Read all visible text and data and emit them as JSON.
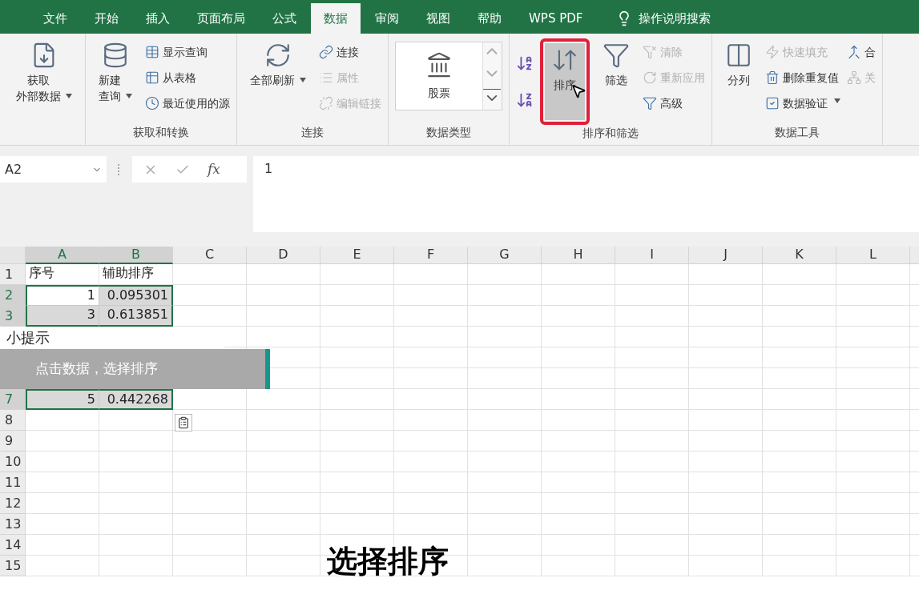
{
  "tabs": [
    {
      "label": "文件",
      "selected": false
    },
    {
      "label": "开始",
      "selected": false
    },
    {
      "label": "插入",
      "selected": false
    },
    {
      "label": "页面布局",
      "selected": false
    },
    {
      "label": "公式",
      "selected": false
    },
    {
      "label": "数据",
      "selected": true
    },
    {
      "label": "审阅",
      "selected": false
    },
    {
      "label": "视图",
      "selected": false
    },
    {
      "label": "帮助",
      "selected": false
    },
    {
      "label": "WPS PDF",
      "selected": false
    }
  ],
  "tell_me": {
    "label": "操作说明搜索"
  },
  "ribbon": {
    "groups": [
      {
        "columns": [
          {
            "kind": "large",
            "lines": [
              "获取",
              "外部数据"
            ],
            "caret": true,
            "selected": false,
            "highlighted": false
          }
        ]
      },
      {
        "label": "获取和转换",
        "columns": [
          {
            "kind": "large",
            "lines": [
              "新建",
              "查询"
            ],
            "caret": true,
            "selected": false,
            "highlighted": false
          },
          {
            "kind": "stack",
            "items": [
              {
                "label": "显示查询",
                "disabled": false
              },
              {
                "label": "从表格",
                "disabled": false
              },
              {
                "label": "最近使用的源",
                "disabled": false
              }
            ]
          }
        ]
      },
      {
        "label": "连接",
        "columns": [
          {
            "kind": "large",
            "lines": [
              "全部刷新"
            ],
            "caret": true,
            "selected": false,
            "highlighted": false
          },
          {
            "kind": "stack",
            "items": [
              {
                "label": "连接",
                "disabled": false
              },
              {
                "label": "属性",
                "disabled": true
              },
              {
                "label": "编辑链接",
                "disabled": true
              }
            ]
          }
        ]
      },
      {
        "label": "数据类型",
        "columns": [
          {
            "kind": "gallery",
            "label": "股票"
          }
        ]
      },
      {
        "label": "排序和筛选",
        "columns": [
          {
            "kind": "sort_buttons"
          },
          {
            "kind": "large",
            "lines": [
              "排序"
            ],
            "caret": false,
            "selected": true,
            "highlighted": true
          },
          {
            "kind": "large",
            "lines": [
              "筛选"
            ],
            "caret": false,
            "selected": false,
            "highlighted": false
          },
          {
            "kind": "stack",
            "items": [
              {
                "label": "清除",
                "disabled": true
              },
              {
                "label": "重新应用",
                "disabled": true
              },
              {
                "label": "高级",
                "disabled": false
              }
            ]
          }
        ]
      },
      {
        "label": "数据工具",
        "columns": [
          {
            "kind": "large",
            "lines": [
              "分列"
            ],
            "caret": false,
            "selected": false,
            "highlighted": false
          },
          {
            "kind": "stack",
            "items": [
              {
                "label": "快速填充",
                "disabled": true
              },
              {
                "label": "删除重复值",
                "disabled": false
              },
              {
                "label": "数据验证",
                "disabled": false,
                "caret": true
              }
            ]
          },
          {
            "kind": "stack",
            "items": [
              {
                "label": "合",
                "disabled": false
              },
              {
                "label": "关",
                "disabled": true
              }
            ]
          }
        ]
      }
    ]
  },
  "formula_bar": {
    "name_box": "A2",
    "function_label": "fx",
    "value": "1"
  },
  "grid": {
    "columns": [
      {
        "label": "A",
        "selected": true
      },
      {
        "label": "B",
        "selected": true
      },
      {
        "label": "C",
        "selected": false
      },
      {
        "label": "D",
        "selected": false
      },
      {
        "label": "E",
        "selected": false
      },
      {
        "label": "F",
        "selected": false
      },
      {
        "label": "G",
        "selected": false
      },
      {
        "label": "H",
        "selected": false
      },
      {
        "label": "I",
        "selected": false
      },
      {
        "label": "J",
        "selected": false
      },
      {
        "label": "K",
        "selected": false
      },
      {
        "label": "L",
        "selected": false
      }
    ],
    "rows": [
      {
        "kind": "row",
        "number": "1",
        "selected": false,
        "active": false,
        "cells": [
          "序号",
          "辅助排序"
        ]
      },
      {
        "kind": "row",
        "number": "2",
        "selected": true,
        "active": true,
        "cells": [
          "1",
          "0.095301"
        ]
      },
      {
        "kind": "row",
        "number": "3",
        "selected": true,
        "active": false,
        "cells": [
          "3",
          "0.613851"
        ]
      },
      {
        "kind": "tip",
        "title": "小提示",
        "text": "点击数据，选择排序"
      },
      {
        "kind": "row",
        "number": "7",
        "selected": true,
        "active": false,
        "cells": [
          "5",
          "0.442268"
        ]
      },
      {
        "kind": "row",
        "number": "8",
        "selected": false,
        "active": false,
        "cells": []
      },
      {
        "kind": "row",
        "number": "9",
        "selected": false,
        "active": false,
        "cells": []
      },
      {
        "kind": "row",
        "number": "10",
        "selected": false,
        "active": false,
        "cells": []
      },
      {
        "kind": "row",
        "number": "11",
        "selected": false,
        "active": false,
        "cells": []
      },
      {
        "kind": "row",
        "number": "12",
        "selected": false,
        "active": false,
        "cells": []
      },
      {
        "kind": "row",
        "number": "13",
        "selected": false,
        "active": false,
        "cells": []
      },
      {
        "kind": "row",
        "number": "14",
        "selected": false,
        "active": false,
        "cells": []
      },
      {
        "kind": "row",
        "number": "15",
        "selected": false,
        "active": false,
        "cells": []
      }
    ]
  },
  "subtitle": "选择排序"
}
